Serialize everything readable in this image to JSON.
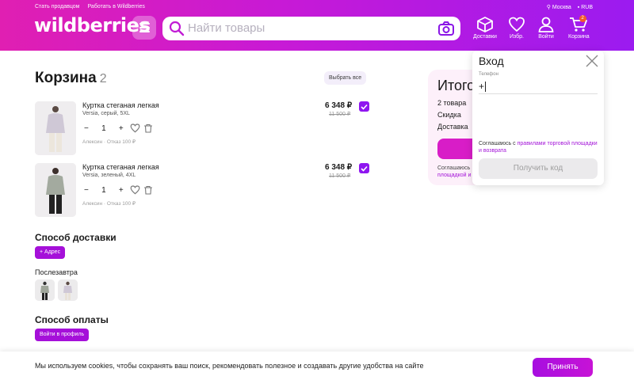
{
  "header": {
    "top_links": [
      "Стать продавцом",
      "Работать в Wildberries"
    ],
    "location": "Москва",
    "currency": "RUB",
    "logo": "wildberries",
    "search_placeholder": "Найти товары",
    "nav": [
      {
        "label": "Доставки",
        "icon": "box-icon"
      },
      {
        "label": "Избр.",
        "icon": "heart-icon"
      },
      {
        "label": "Войти",
        "icon": "user-icon"
      },
      {
        "label": "Корзина",
        "icon": "cart-icon",
        "badge": "2"
      }
    ]
  },
  "cart": {
    "title": "Корзина",
    "count": "2",
    "select_all": "Выбрать все",
    "items": [
      {
        "name": "Куртка стеганая легкая",
        "meta": "Versia, серый, 5XL",
        "qty": "1",
        "seller": "Алексин · Отказ 100 ₽",
        "price": "6 348 ₽",
        "old_price": "11 500 ₽",
        "color": "#c9c3cf"
      },
      {
        "name": "Куртка стеганая легкая",
        "meta": "Versia, зеленый, 4XL",
        "qty": "1",
        "seller": "Алексин · Отказ 100 ₽",
        "price": "6 348 ₽",
        "old_price": "11 500 ₽",
        "color": "#9fa59a"
      }
    ]
  },
  "delivery": {
    "title": "Способ доставки",
    "address_btn": "+ Адрес",
    "day": "Послезавтра"
  },
  "payment": {
    "title": "Способ оплаты",
    "btn": "Войти в профиль"
  },
  "summary": {
    "title": "Итого",
    "rows": [
      "2 товара",
      "Скидка",
      "Доставка"
    ],
    "agree_prefix": "Соглашаюсь",
    "agree_link": "площадкой и"
  },
  "login": {
    "title": "Вход",
    "phone_label": "Телефон",
    "phone_value": "+",
    "terms_prefix": "Соглашаюсь с ",
    "terms_link": "правилами торговой площадки и возврата",
    "get_code": "Получить код"
  },
  "cookie": {
    "text": "Мы используем cookies, чтобы сохранять ваш поиск, рекомендовать полезное и создавать другие удобства на сайте",
    "accept": "Принять"
  }
}
